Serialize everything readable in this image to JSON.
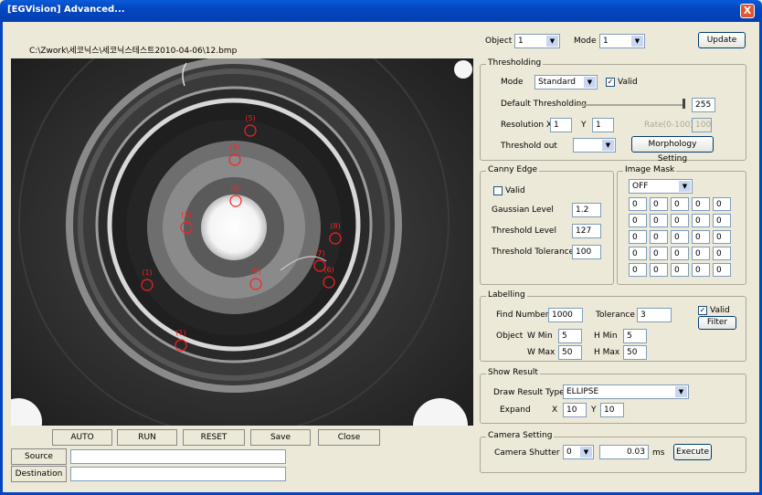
{
  "window": {
    "title": "[EGVision] Advanced...",
    "close_glyph": "X"
  },
  "image_path": "C:\\Zwork\\세코닉스\\세코닉스테스트2010-04-06\\12.bmp",
  "top": {
    "object_label": "Object",
    "object_value": "1",
    "mode_label": "Mode",
    "mode_value": "1",
    "update_label": "Update"
  },
  "thresholding": {
    "title": "Thresholding",
    "mode_label": "Mode",
    "mode_value": "Standard",
    "valid_label": "Valid",
    "valid_checked": "✓",
    "default_label": "Default Thresholding",
    "default_value": "255",
    "resolution_label": "Resolution X",
    "res_x": "1",
    "y_label": "Y",
    "res_y": "1",
    "rate_label": "Rate(0-100)",
    "rate_value": "100",
    "threshold_out_label": "Threshold out",
    "threshold_out_value": "",
    "morphology_label": "Morphology Setting"
  },
  "canny": {
    "title": "Canny Edge",
    "valid_label": "Valid",
    "gaussian_label": "Gaussian Level",
    "gaussian_value": "1.2",
    "threshold_label": "Threshold Level",
    "threshold_value": "127",
    "tolerance_label": "Threshold Tolerance",
    "tolerance_value": "100"
  },
  "mask": {
    "title": "Image Mask",
    "value": "OFF",
    "grid": [
      [
        "0",
        "0",
        "0",
        "0",
        "0"
      ],
      [
        "0",
        "0",
        "0",
        "0",
        "0"
      ],
      [
        "0",
        "0",
        "0",
        "0",
        "0"
      ],
      [
        "0",
        "0",
        "0",
        "0",
        "0"
      ],
      [
        "0",
        "0",
        "0",
        "0",
        "0"
      ]
    ]
  },
  "labelling": {
    "title": "Labelling",
    "find_label": "Find Number",
    "find_value": "1000",
    "tol_label": "Tolerance",
    "tol_value": "3",
    "valid_label": "Valid",
    "valid_checked": "✓",
    "filter_label": "Filter",
    "object_label": "Object",
    "wmin_label": "W Min",
    "wmin": "5",
    "hmin_label": "H Min",
    "hmin": "5",
    "wmax_label": "W Max",
    "wmax": "50",
    "hmax_label": "H Max",
    "hmax": "50"
  },
  "show_result": {
    "title": "Show Result",
    "draw_label": "Draw Result Type",
    "draw_value": "ELLIPSE",
    "expand_label": "Expand",
    "x_label": "X",
    "x_value": "10",
    "y_label": "Y",
    "y_value": "10"
  },
  "camera": {
    "title": "Camera Setting",
    "shutter_label": "Camera Shutter",
    "shutter_value": "0",
    "ms_value": "0.03",
    "ms_label": "ms",
    "execute_label": "Execute"
  },
  "actions": {
    "auto": "AUTO",
    "run": "RUN",
    "reset": "RESET",
    "save": "Save",
    "close": "Close"
  },
  "source": {
    "label": "Source",
    "value": ""
  },
  "destination": {
    "label": "Destination",
    "value": ""
  },
  "detections": [
    "(5)",
    "(3)",
    "(4)",
    "(2)",
    "(8)",
    "(7)",
    "(6)",
    "(9)",
    "(1)",
    "(1)"
  ],
  "colors": {
    "detection": "#ff2020",
    "titlebar": "#0446c0"
  }
}
